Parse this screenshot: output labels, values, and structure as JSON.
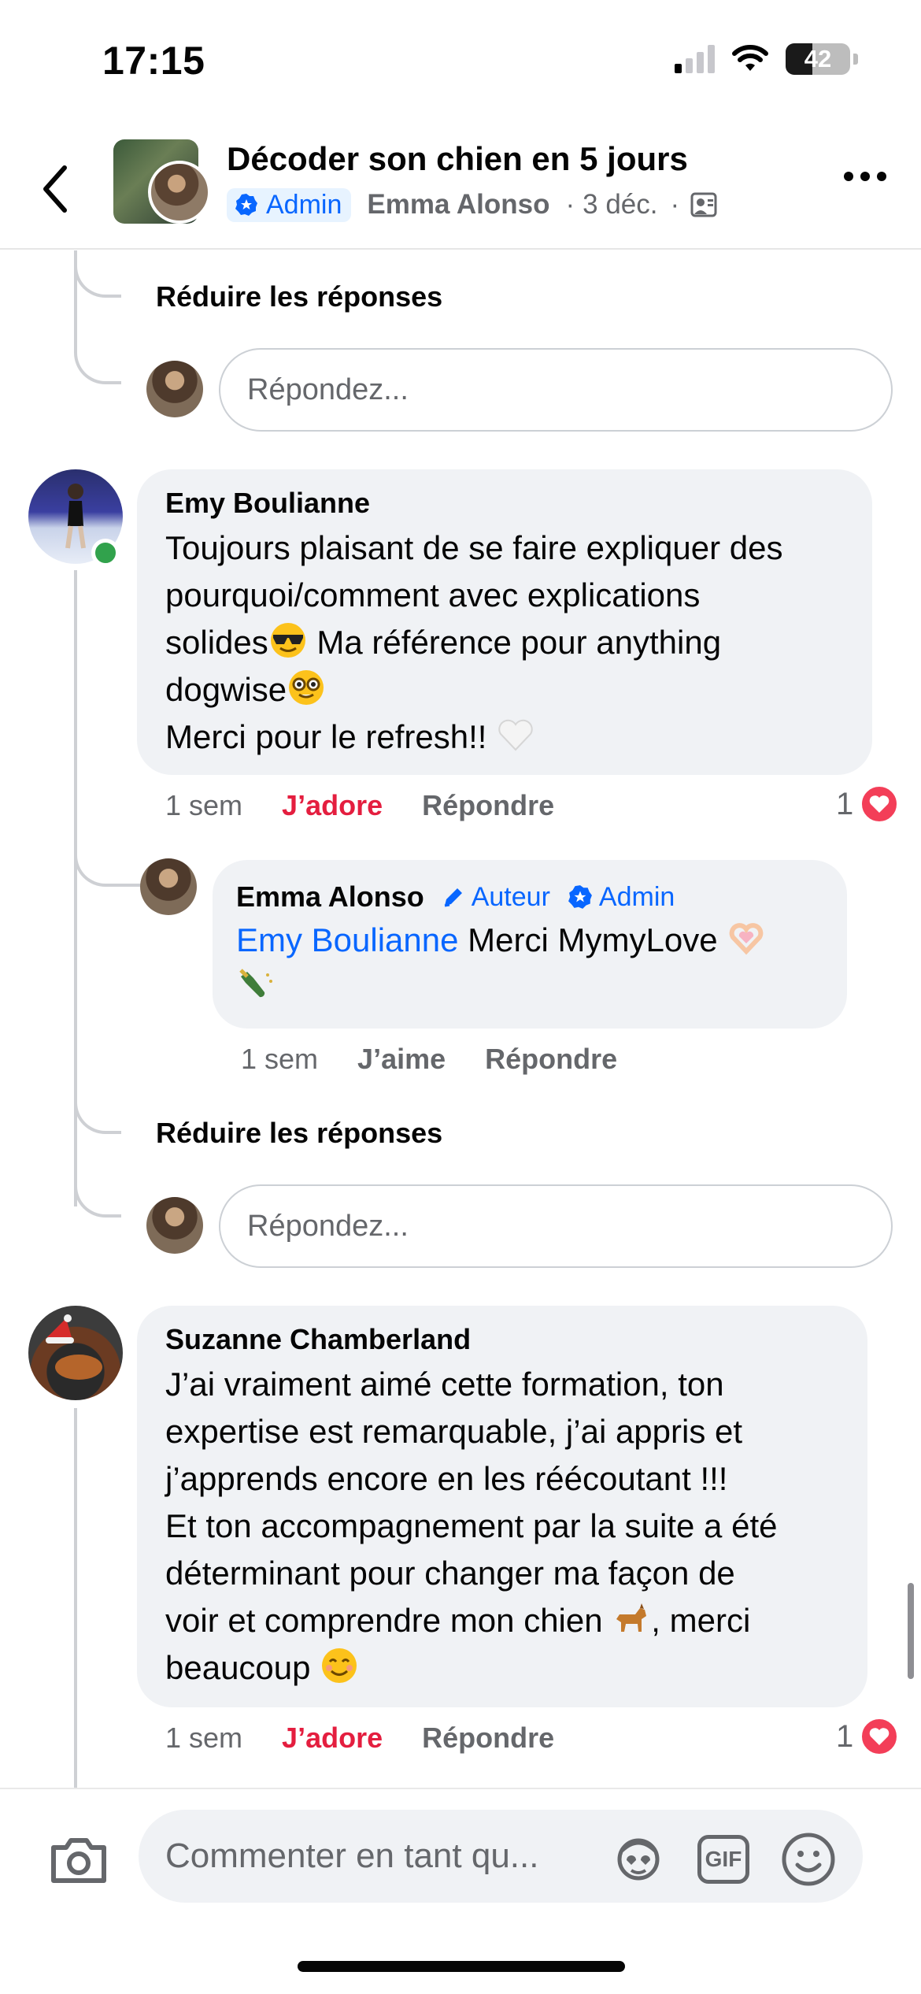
{
  "status_bar": {
    "time": "17:15",
    "battery": "42",
    "battery_level": 0.42
  },
  "header": {
    "title": "Décoder son chien en 5 jours",
    "admin_badge": "Admin",
    "author": "Emma Alonso",
    "separator": "·",
    "date": "3 déc.",
    "back_icon": "chevron-left-icon",
    "more_icon": "more-dots-icon"
  },
  "thread_top": {
    "collapse_label": "Réduire les réponses",
    "reply_placeholder": "Répondez..."
  },
  "comments": [
    {
      "author": "Emy Boulianne",
      "lines": [
        "Toujours plaisant de se faire expliquer des",
        "pourquoi/comment avec explications",
        "solides",
        " Ma référence pour anything",
        "dogwise",
        "Merci pour le refresh!! "
      ],
      "time": "1 sem",
      "reaction_label": "J’adore",
      "reply_label": "Répondre",
      "reaction_count": "1",
      "online": true,
      "reply": {
        "author": "Emma Alonso",
        "author_tag": "Auteur",
        "admin_tag": "Admin",
        "mention": "Emy Boulianne",
        "text": " Merci MymyLove",
        "time": "1 sem",
        "like_label": "J’aime",
        "reply_label": "Répondre"
      },
      "collapse_label": "Réduire les réponses",
      "reply_placeholder": "Répondez..."
    },
    {
      "author": "Suzanne Chamberland",
      "lines": [
        "J’ai vraiment aimé cette formation, ton",
        "expertise est remarquable, j’ai appris et",
        "j’apprends encore en les réécoutant !!!",
        "Et ton accompagnement par la suite a été",
        "déterminant pour changer ma façon de",
        "voir et comprendre mon chien ",
        ", merci",
        "beaucoup "
      ],
      "time": "1 sem",
      "reaction_label": "J’adore",
      "reply_label": "Répondre",
      "reaction_count": "1"
    }
  ],
  "composer": {
    "placeholder": "Commenter en tant qu...",
    "camera_icon": "camera-icon",
    "avatar_icon": "avatar-sticker-icon",
    "gif_label": "GIF",
    "emoji_icon": "emoji-icon"
  },
  "colors": {
    "accent": "#0866ff",
    "love": "#e41e3f",
    "bubble": "#f0f2f5",
    "secondary_text": "#65676b",
    "online": "#31a24c"
  }
}
